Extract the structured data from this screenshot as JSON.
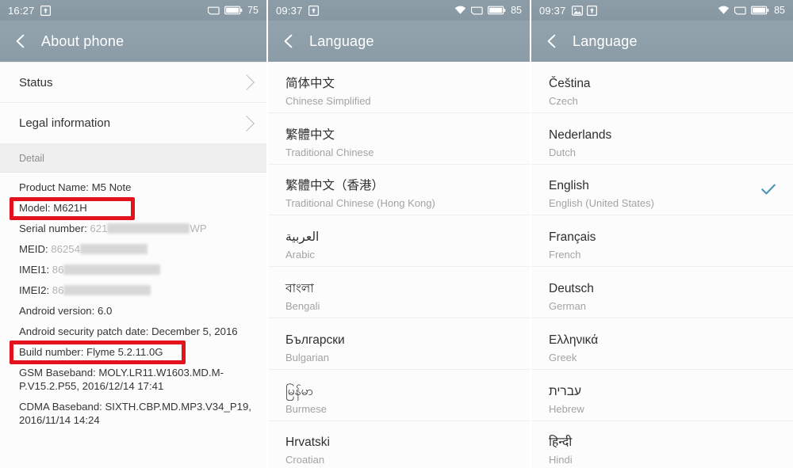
{
  "panels": [
    {
      "id": "about-phone",
      "statusbar": {
        "time": "16:27",
        "left_icons": [
          "upload-icon"
        ],
        "right_icons": [
          "sim-card-icon",
          "battery-icon"
        ],
        "battery_level": "75"
      },
      "title": "About phone",
      "nav_rows": [
        {
          "label": "Status"
        },
        {
          "label": "Legal information"
        }
      ],
      "section_label": "Detail",
      "details": [
        {
          "label": "Product Name: M5 Note",
          "masked": false,
          "highlight": false
        },
        {
          "label": "Model: M621H",
          "masked": false,
          "highlight": "model"
        },
        {
          "label": "Serial number: ",
          "value": "621",
          "tail": "WP",
          "masked": true,
          "mask_width": 118,
          "highlight": false
        },
        {
          "label": "MEID: ",
          "value": "86254",
          "masked": true,
          "mask_width": 88,
          "highlight": false
        },
        {
          "label": "IMEI1: ",
          "value": "86",
          "masked": true,
          "mask_width": 120,
          "highlight": false
        },
        {
          "label": "IMEI2: ",
          "value": "86",
          "masked": true,
          "mask_width": 110,
          "highlight": false
        },
        {
          "label": "Android version: 6.0",
          "masked": false,
          "highlight": false
        },
        {
          "label": "Android security patch date: December 5, 2016",
          "masked": false,
          "highlight": false
        },
        {
          "label": "Build number: Flyme 5.2.11.0G",
          "masked": false,
          "highlight": "build"
        },
        {
          "label": "GSM Baseband: MOLY.LR11.W1603.MD.M-P.V15.2.P55, 2016/12/14 17:41",
          "masked": false,
          "highlight": false
        },
        {
          "label": "CDMA Baseband: SIXTH.CBP.MD.MP3.V34_P19, 2016/11/14 14:24",
          "masked": false,
          "highlight": false
        }
      ]
    },
    {
      "id": "language-page-1",
      "statusbar": {
        "time": "09:37",
        "left_icons": [
          "upload-icon"
        ],
        "right_icons": [
          "wifi-icon",
          "sim-card-icon",
          "battery-icon"
        ],
        "battery_level": "85"
      },
      "title": "Language",
      "languages": [
        {
          "native": "简体中文",
          "english": "Chinese Simplified",
          "selected": false
        },
        {
          "native": "繁體中文",
          "english": "Traditional Chinese",
          "selected": false
        },
        {
          "native": "繁體中文（香港）",
          "english": "Traditional Chinese (Hong Kong)",
          "selected": false
        },
        {
          "native": "العربية",
          "english": "Arabic",
          "selected": false
        },
        {
          "native": "বাংলা",
          "english": "Bengali",
          "selected": false
        },
        {
          "native": "Български",
          "english": "Bulgarian",
          "selected": false
        },
        {
          "native": "မြန်မာ",
          "english": "Burmese",
          "selected": false
        },
        {
          "native": "Hrvatski",
          "english": "Croatian",
          "selected": false
        }
      ]
    },
    {
      "id": "language-page-2",
      "statusbar": {
        "time": "09:37",
        "left_icons": [
          "screenshot-icon",
          "upload-icon"
        ],
        "right_icons": [
          "wifi-icon",
          "sim-card-icon",
          "battery-icon"
        ],
        "battery_level": "85"
      },
      "title": "Language",
      "languages": [
        {
          "native": "Čeština",
          "english": "Czech",
          "selected": false
        },
        {
          "native": "Nederlands",
          "english": "Dutch",
          "selected": false
        },
        {
          "native": "English",
          "english": "English (United States)",
          "selected": true
        },
        {
          "native": "Français",
          "english": "French",
          "selected": false
        },
        {
          "native": "Deutsch",
          "english": "German",
          "selected": false
        },
        {
          "native": "Ελληνικά",
          "english": "Greek",
          "selected": false
        },
        {
          "native": "עברית",
          "english": "Hebrew",
          "selected": false
        },
        {
          "native": "हिन्दी",
          "english": "Hindi",
          "selected": false
        }
      ]
    }
  ],
  "colors": {
    "statusbar_bg": "#8a9aa4",
    "titlebar_bg": "#8f9fa9",
    "highlight_red": "#e3121c",
    "check_teal": "#4a95b5",
    "page_bg": "#fcfcfc",
    "section_band_bg": "#efefef"
  }
}
